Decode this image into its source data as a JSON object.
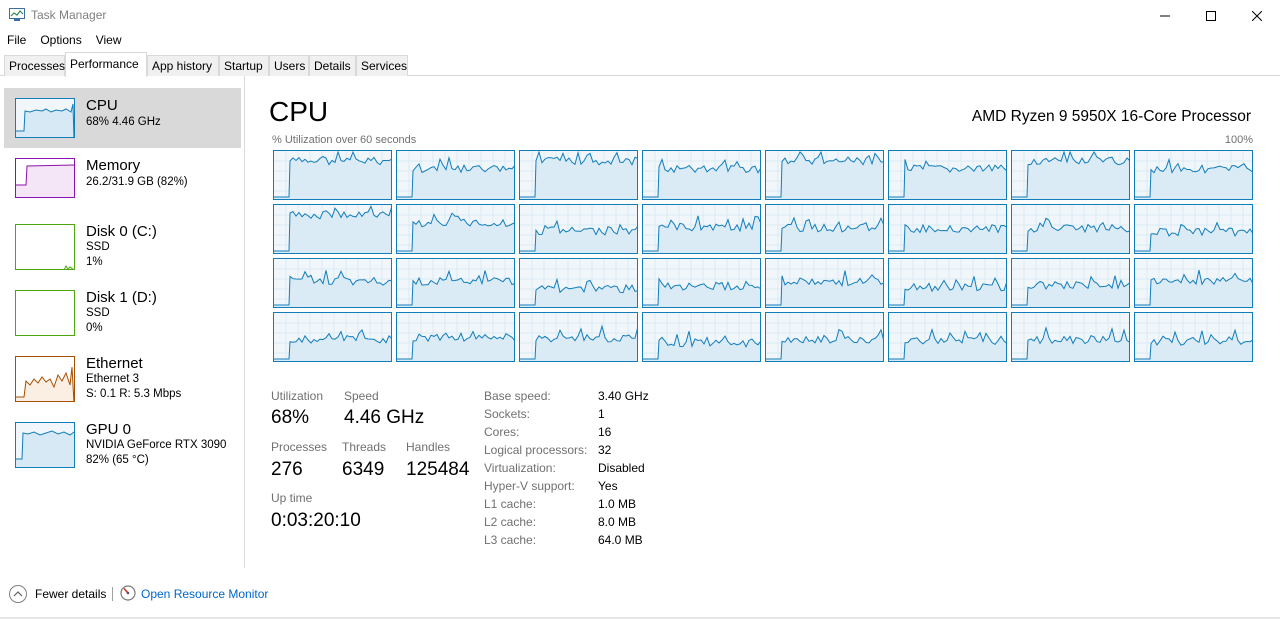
{
  "window": {
    "title": "Task Manager"
  },
  "menu": [
    "File",
    "Options",
    "View"
  ],
  "tabs": [
    "Processes",
    "Performance",
    "App history",
    "Startup",
    "Users",
    "Details",
    "Services"
  ],
  "active_tab": "Performance",
  "sidebar": {
    "items": [
      {
        "name": "CPU",
        "line1": "68% 4.46 GHz",
        "line2": "",
        "line3": "",
        "color": "#117dbb",
        "icon": "cpu-graph-icon"
      },
      {
        "name": "Memory",
        "line1": "26.2/31.9 GB (82%)",
        "line2": "",
        "line3": "",
        "color": "#8b12ae",
        "icon": "memory-graph-icon"
      },
      {
        "name": "Disk 0 (C:)",
        "line1": "SSD",
        "line2": "1%",
        "line3": "",
        "color": "#4da60c",
        "icon": "disk-graph-icon"
      },
      {
        "name": "Disk 1 (D:)",
        "line1": "SSD",
        "line2": "0%",
        "line3": "",
        "color": "#4da60c",
        "icon": "disk-graph-icon"
      },
      {
        "name": "Ethernet",
        "line1": "Ethernet 3",
        "line2": "S: 0.1  R: 5.3 Mbps",
        "line3": "",
        "color": "#a74f01",
        "icon": "ethernet-graph-icon"
      },
      {
        "name": "GPU 0",
        "line1": "NVIDIA GeForce RTX 3090",
        "line2": "82% (65 °C)",
        "line3": "",
        "color": "#117dbb",
        "icon": "gpu-graph-icon"
      }
    ]
  },
  "main": {
    "title": "CPU",
    "processor": "AMD Ryzen 9 5950X 16-Core Processor",
    "graph_label": "% Utilization over 60 seconds",
    "graph_max": "100%",
    "logical_processors_shown": 32,
    "stats": {
      "utilization_label": "Utilization",
      "utilization": "68%",
      "speed_label": "Speed",
      "speed": "4.46 GHz",
      "processes_label": "Processes",
      "processes": "276",
      "threads_label": "Threads",
      "threads": "6349",
      "handles_label": "Handles",
      "handles": "125484",
      "uptime_label": "Up time",
      "uptime": "0:03:20:10"
    },
    "details": [
      {
        "key": "Base speed:",
        "value": "3.40 GHz"
      },
      {
        "key": "Sockets:",
        "value": "1"
      },
      {
        "key": "Cores:",
        "value": "16"
      },
      {
        "key": "Logical processors:",
        "value": "32"
      },
      {
        "key": "Virtualization:",
        "value": "Disabled"
      },
      {
        "key": "Hyper-V support:",
        "value": "Yes"
      },
      {
        "key": "L1 cache:",
        "value": "1.0 MB"
      },
      {
        "key": "L2 cache:",
        "value": "8.0 MB"
      },
      {
        "key": "L3 cache:",
        "value": "64.0 MB"
      }
    ]
  },
  "footer": {
    "fewer_details": "Fewer details",
    "resource_monitor": "Open Resource Monitor"
  },
  "colors": {
    "cpu": "#117dbb",
    "memory": "#8b12ae",
    "disk": "#4da60c",
    "ethernet": "#a74f01",
    "link": "#0066cc"
  }
}
